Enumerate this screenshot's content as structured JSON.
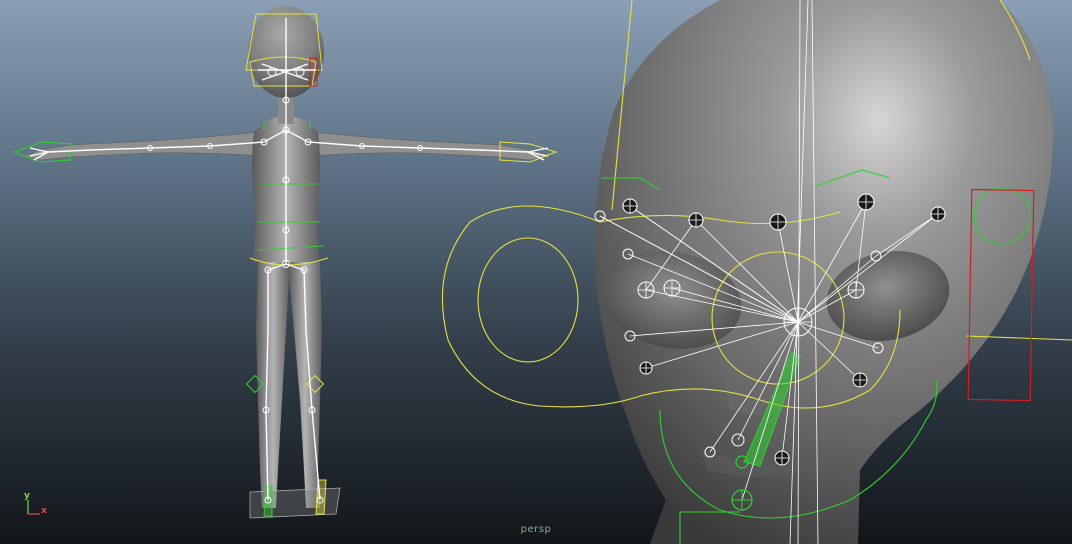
{
  "viewport": {
    "camera_label": "persp",
    "axis_labels": {
      "x": "x",
      "y": "y"
    }
  },
  "colors": {
    "bg_top": "#8a9fb5",
    "bg_bottom": "#12161a",
    "mesh": "#9a9a9a",
    "joint": "#ffffff",
    "control_yellow": "#e8e040",
    "control_green": "#30d030",
    "control_red": "#d02020"
  }
}
